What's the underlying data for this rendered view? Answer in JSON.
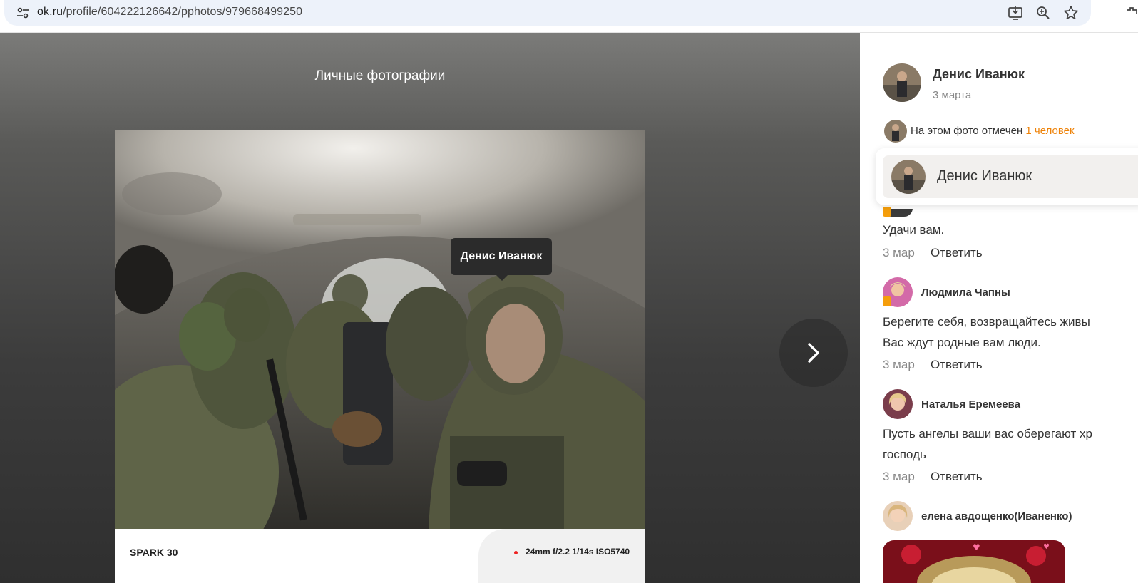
{
  "browser": {
    "url_host": "ok.ru",
    "url_path": "/profile/604222126642/pphotos/979668499250",
    "icons": [
      "site-settings-icon",
      "install-app-icon",
      "zoom-icon",
      "bookmark-star-icon",
      "extensions-icon"
    ]
  },
  "viewer": {
    "album_title": "Личные фотографии",
    "tag_label": "Денис Иванюк",
    "device": "SPARK 30",
    "exif": "24mm f/2.2 1/14s ISO5740",
    "next_icon": "chevron-right-icon"
  },
  "sidebar": {
    "author": {
      "name": "Денис Иванюк",
      "date": "3 марта"
    },
    "tags": {
      "prefix": "На этом фото отмечен",
      "link": "1 человек"
    },
    "tag_popup": {
      "name": "Денис Иванюк"
    },
    "comments": [
      {
        "author": "",
        "text": [
          "Удачи вам."
        ],
        "date": "3 мар",
        "reply": "Ответить"
      },
      {
        "author": "Людмила Чапны",
        "text": [
          "Берегите себя, возвращайтесь живы",
          "Вас ждут родные вам люди."
        ],
        "date": "3 мар",
        "reply": "Ответить"
      },
      {
        "author": "Наталья Еремеева",
        "text": [
          "Пусть ангелы ваши вас оберегают хр",
          "господь"
        ],
        "date": "3 мар",
        "reply": "Ответить"
      },
      {
        "author": "елена авдощенко(Иваненко)",
        "text": [],
        "date": "",
        "reply": ""
      }
    ]
  },
  "colors": {
    "accent_orange": "#ee8208",
    "badge": "#f59e0b",
    "exif_dot": "#e22222"
  }
}
